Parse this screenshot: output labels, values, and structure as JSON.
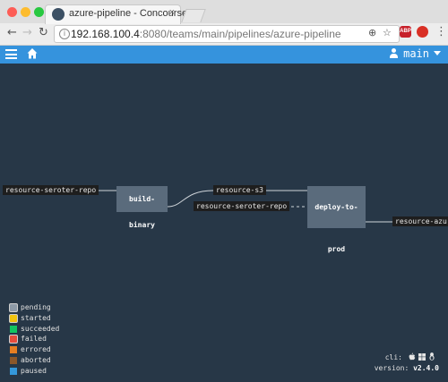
{
  "browser": {
    "tab_title": "azure-pipeline - Concourse",
    "tab_close": "×",
    "url_host": "192.168.100.4",
    "url_path": ":8080/teams/main/pipelines/azure-pipeline",
    "extension_label": "ABP",
    "colors": {
      "close": "#fd5d56",
      "minimize": "#fdbc2e",
      "maximize": "#28c840"
    }
  },
  "appbar": {
    "user": "main",
    "color": "#3593dd"
  },
  "pipeline": {
    "resources": [
      {
        "label": "resource-seroter-repo"
      },
      {
        "label": "resource-s3"
      },
      {
        "label": "resource-seroter-repo"
      },
      {
        "label": "resource-azure"
      }
    ],
    "jobs": [
      {
        "label": "build-binary"
      },
      {
        "label": "deploy-to-prod"
      }
    ]
  },
  "legend": [
    {
      "label": "pending",
      "color": "#8d9aa7",
      "bordered": true
    },
    {
      "label": "started",
      "color": "#f1c40f",
      "bordered": true
    },
    {
      "label": "succeeded",
      "color": "#11c560",
      "bordered": false
    },
    {
      "label": "failed",
      "color": "#e74c3c",
      "bordered": true
    },
    {
      "label": "errored",
      "color": "#e67e22",
      "bordered": false
    },
    {
      "label": "aborted",
      "color": "#8b572a",
      "bordered": false
    },
    {
      "label": "paused",
      "color": "#3498db",
      "bordered": false
    }
  ],
  "footer": {
    "cli_label": "cli:",
    "version_label": "version:",
    "version": "v2.4.0",
    "cli_icons": [
      "apple-icon",
      "windows-icon",
      "linux-icon"
    ]
  }
}
